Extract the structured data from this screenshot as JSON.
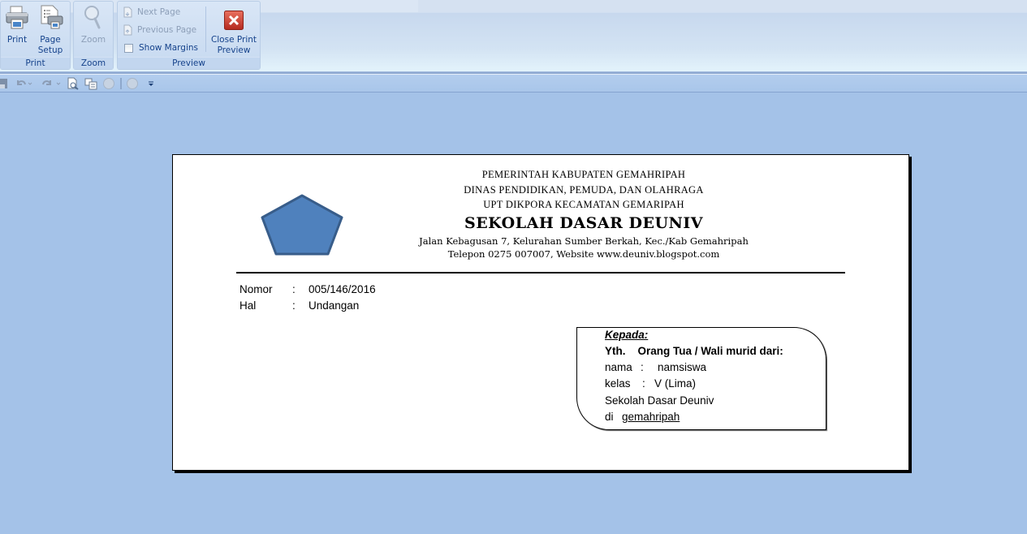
{
  "ribbon": {
    "groups": {
      "print": {
        "label": "Print",
        "print_button": {
          "label_1": "Print",
          "icon": "printer-icon"
        },
        "page_setup_button": {
          "label_1": "Page",
          "label_2": "Setup",
          "icon": "page-setup-icon"
        }
      },
      "zoom": {
        "label": "Zoom",
        "zoom_button": {
          "label": "Zoom",
          "icon": "magnifier-icon",
          "enabled": false
        }
      },
      "preview": {
        "label": "Preview",
        "next_page": {
          "label": "Next Page",
          "enabled": false
        },
        "previous_page": {
          "label": "Previous Page",
          "enabled": false
        },
        "show_margins": {
          "label": "Show Margins",
          "checked": false
        },
        "close_button": {
          "label_1": "Close Print",
          "label_2": "Preview",
          "icon": "close-x-icon",
          "color": "#c8372b"
        }
      }
    }
  },
  "quick_access": {
    "items": [
      "save-icon",
      "undo-icon",
      "redo-icon",
      "print-preview-icon",
      "copy-icon",
      "disabled-circle-icon",
      "disabled-circle-icon",
      "customize-dropdown-icon"
    ]
  },
  "document": {
    "letterhead": {
      "line1": "PEMERINTAH KABUPATEN GEMAHRIPAH",
      "line2": "DINAS PENDIDIKAN, PEMUDA, DAN OLAHRAGA",
      "line3": "UPT DIKPORA KECAMATAN GEMARIPAH",
      "school": "SEKOLAH DASAR DEUNIV",
      "address": "Jalan Kebagusan 7, Kelurahan Sumber Berkah, Kec./Kab Gemahripah",
      "contact": "Telepon 0275 007007, Website www.deuniv.blogspot.com",
      "logo_color": "#4f81bd",
      "logo_border": "#385d8a"
    },
    "meta": {
      "nomor_label": "Nomor",
      "nomor_sep": ":",
      "nomor_value": "005/146/2016",
      "hal_label": "Hal",
      "hal_sep": ":",
      "hal_value": "Undangan"
    },
    "recipient": {
      "kepada": "Kepada:",
      "yth": "Yth.",
      "yth_text": "Orang Tua / Wali murid dari:",
      "nama_label": "nama",
      "nama_sep": ":",
      "nama_value": "namsiswa",
      "kelas_label": "kelas",
      "kelas_sep": ":",
      "kelas_value": "V (Lima)",
      "school": "Sekolah Dasar Deuniv",
      "di_label": "di",
      "di_value": "gemahripah"
    }
  }
}
